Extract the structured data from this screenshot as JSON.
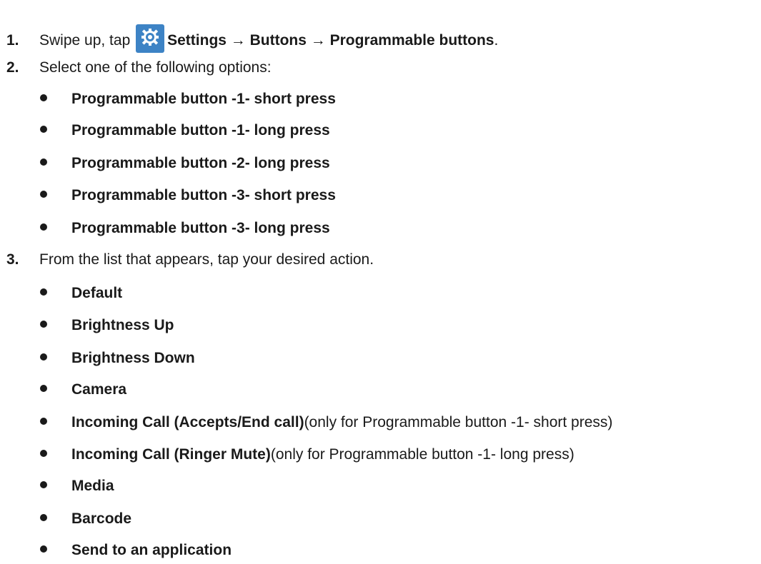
{
  "steps": [
    {
      "number": "1.",
      "prefix": "Swipe up, tap",
      "icon": "settings-gear-icon",
      "icon_color": "#3d83c5",
      "path": "Settings → Buttons → Programmable buttons",
      "suffix": "."
    },
    {
      "number": "2.",
      "text": "Select one of the following options:",
      "options": [
        "Programmable button -1- short press",
        "Programmable button -1- long press",
        "Programmable button -2- long press",
        "Programmable button -3- short press",
        "Programmable button -3- long press"
      ]
    },
    {
      "number": "3.",
      "text": "From the list that appears, tap your desired action.",
      "actions": [
        {
          "label": "Default",
          "note": ""
        },
        {
          "label": "Brightness Up",
          "note": ""
        },
        {
          "label": "Brightness Down",
          "note": ""
        },
        {
          "label": "Camera",
          "note": ""
        },
        {
          "label": "Incoming Call (Accepts/End call)",
          "note": "(only for Programmable button -1- short press)"
        },
        {
          "label": "Incoming Call (Ringer Mute)",
          "note": "(only for Programmable button -1- long press)"
        },
        {
          "label": "Media",
          "note": ""
        },
        {
          "label": "Barcode",
          "note": ""
        },
        {
          "label": "Send to an application",
          "note": ""
        }
      ]
    }
  ]
}
